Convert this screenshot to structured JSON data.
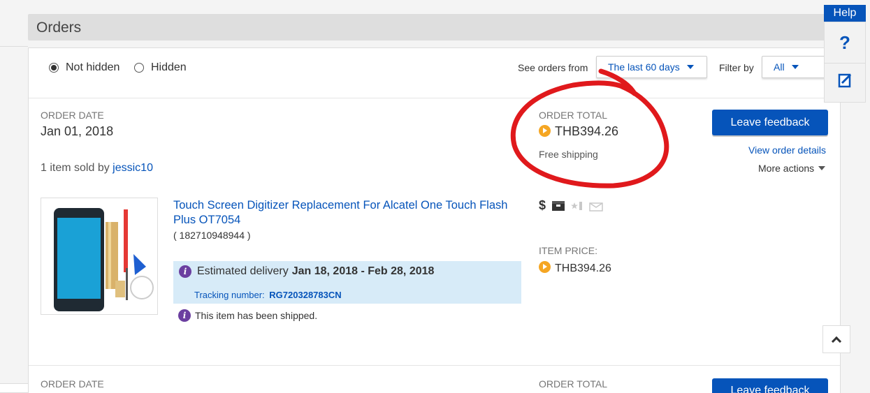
{
  "page": {
    "title": "Orders"
  },
  "filters": {
    "not_hidden_label": "Not hidden",
    "hidden_label": "Hidden",
    "see_orders_from_label": "See orders from",
    "range_value": "The last 60 days",
    "filter_by_label": "Filter by",
    "filter_value": "All"
  },
  "order": {
    "date_label": "ORDER DATE",
    "date_value": "Jan 01, 2018",
    "total_label": "ORDER TOTAL",
    "total_value": "THB394.26",
    "shipping": "Free shipping",
    "sold_prefix": "1 item sold by",
    "seller": "jessic10",
    "leave_feedback": "Leave feedback",
    "view_details": "View order details",
    "more_actions": "More actions"
  },
  "item": {
    "title": "Touch Screen Digitizer Replacement For Alcatel One Touch Flash Plus OT7054",
    "id": "( 182710948944 )",
    "price_label": "ITEM PRICE:",
    "price_value": "THB394.26",
    "estimated_label": "Estimated delivery",
    "estimated_dates": "Jan 18, 2018 - Feb 28, 2018",
    "tracking_label": "Tracking number:",
    "tracking_number": "RG720328783CN",
    "shipped_status": "This item has been shipped.",
    "status_icons": [
      "dollar-icon",
      "package-icon",
      "star-feedback-icon",
      "envelope-icon"
    ],
    "dollar_symbol": "$"
  },
  "next_order": {
    "date_label": "ORDER DATE",
    "total_label": "ORDER TOTAL",
    "leave_feedback": "Leave feedback"
  },
  "help": {
    "tab_label": "Help",
    "question_symbol": "?"
  },
  "colors": {
    "link": "#0654ba",
    "button": "#0654ba",
    "coin": "#f5a623",
    "info": "#6b3fa0",
    "estimate_bg": "#d7ebf8",
    "annotation": "#e0191c"
  }
}
